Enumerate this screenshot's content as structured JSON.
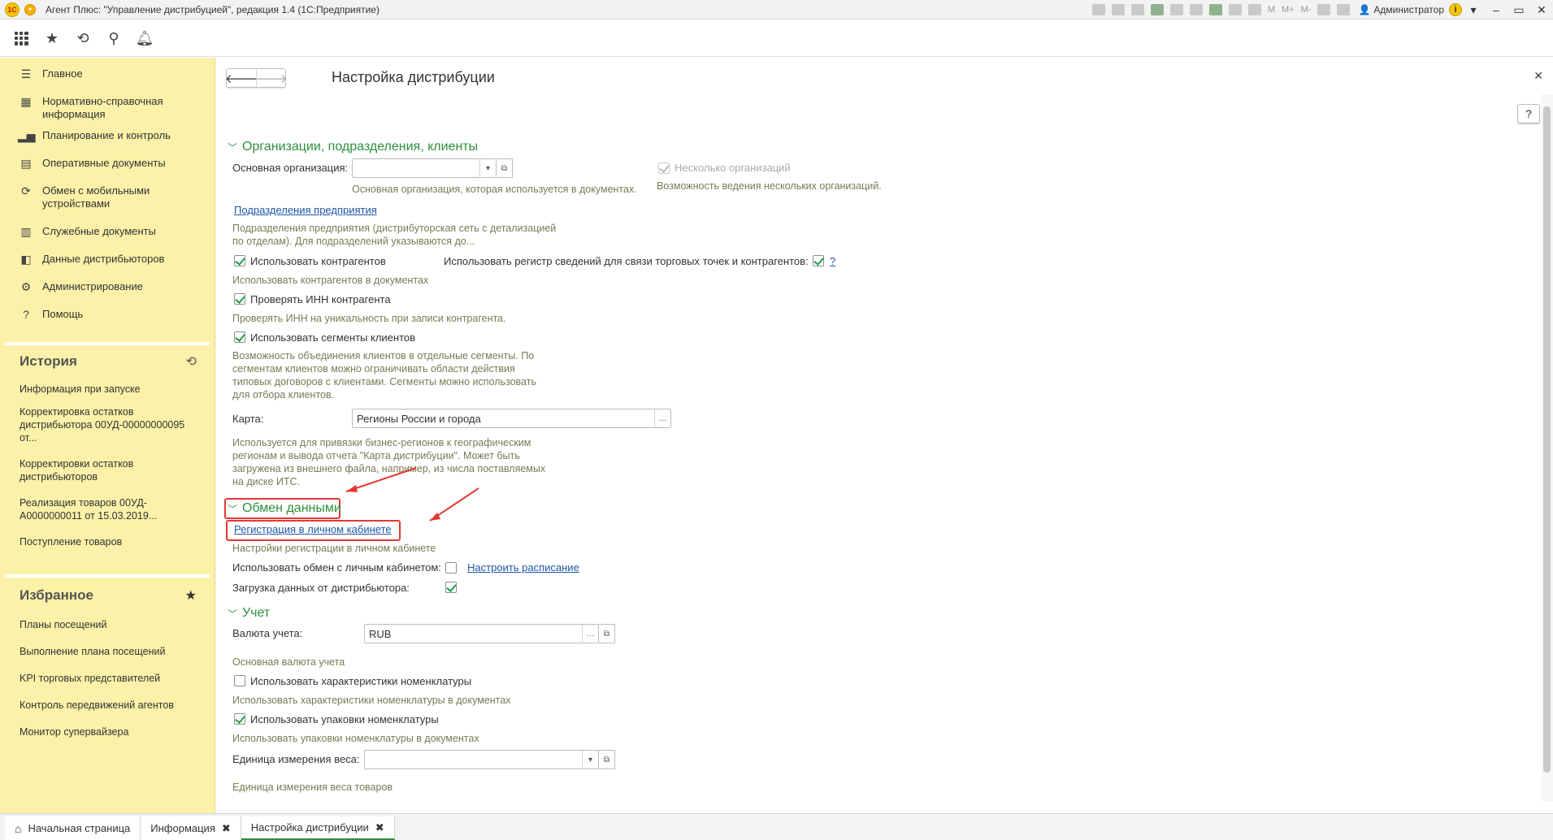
{
  "window": {
    "title": "Агент Плюс: \"Управление дистрибуцией\", редакция 1.4  (1С:Предприятие)",
    "user": "Администратор",
    "toolbar_labels": [
      "M",
      "M+",
      "M-"
    ]
  },
  "sidebar": {
    "nav": [
      {
        "label": "Главное",
        "icon": "menu-lines-icon"
      },
      {
        "label": "Нормативно-справочная информация",
        "icon": "directory-icon"
      },
      {
        "label": "Планирование и контроль",
        "icon": "chart-icon"
      },
      {
        "label": "Оперативные документы",
        "icon": "document-icon"
      },
      {
        "label": "Обмен с мобильными устройствами",
        "icon": "sync-icon"
      },
      {
        "label": "Служебные документы",
        "icon": "service-docs-icon"
      },
      {
        "label": "Данные дистрибьюторов",
        "icon": "distributor-data-icon"
      },
      {
        "label": "Администрирование",
        "icon": "gear-icon"
      },
      {
        "label": "Помощь",
        "icon": "question-icon"
      }
    ],
    "history": {
      "title": "История",
      "items": [
        "Информация при запуске",
        "Корректировка остатков дистрибьютора 00УД-00000000095 от...",
        "Корректировки остатков дистрибьюторов",
        "Реализация товаров 00УД-А0000000011 от 15.03.2019...",
        "Поступление товаров"
      ]
    },
    "favorites": {
      "title": "Избранное",
      "items": [
        "Планы посещений",
        "Выполнение плана посещений",
        "KPI торговых представителей",
        "Контроль передвижений агентов",
        "Монитор супервайзера"
      ]
    }
  },
  "main": {
    "title": "Настройка дистрибуции",
    "help": "?",
    "groups": {
      "orgs": "Организации, подразделения, клиенты",
      "exchange": "Обмен данными",
      "accounting": "Учет"
    },
    "main_org_label": "Основная организация:",
    "main_org_value": "",
    "main_org_hint": "Основная организация, которая используется в документах.",
    "multi_org_label": "Несколько организаций",
    "multi_org_hint": "Возможность ведения нескольких организаций.",
    "divisions_link": "Подразделения предприятия",
    "divisions_hint": "Подразделения предприятия (дистрибуторская сеть с детализацией по отделам). Для подразделений указываются до...",
    "use_contractors": "Использовать контрагентов",
    "use_contractors_hint": "Использовать контрагентов в документах",
    "use_register": "Использовать регистр сведений для связи торговых точек и контрагентов:",
    "use_register_q": "?",
    "check_inn": "Проверять ИНН контрагента",
    "check_inn_hint": "Проверять ИНН на уникальность при записи контрагента.",
    "use_segments": "Использовать сегменты клиентов",
    "segments_hint": "Возможность объединения клиентов в отдельные сегменты. По сегментам клиентов можно ограничивать области действия типовых договоров с клиентами. Сегменты можно использовать для отбора клиентов.",
    "map_label": "Карта:",
    "map_value": "Регионы России и города",
    "map_hint": "Используется для привязки бизнес-регионов к географическим регионам и вывода отчета \"Карта дистрибуции\". Может быть загружена из внешнего файла, например, из числа поставляемых на диске ИТС.",
    "reg_link": "Регистрация в личном кабинете",
    "reg_hint": "Настройки регистрации в личном кабинете",
    "use_exchange": "Использовать обмен с личным кабинетом:",
    "schedule_link": "Настроить расписание",
    "load_data": "Загрузка данных от дистрибьютора:",
    "currency_label": "Валюта учета:",
    "currency_value": "RUB",
    "currency_hint": "Основная валюта учета",
    "use_chars": "Использовать характеристики номенклатуры",
    "use_chars_hint": "Использовать характеристики номенклатуры в документах",
    "use_packs": "Использовать упаковки номенклатуры",
    "use_packs_hint": "Использовать упаковки номенклатуры в документах",
    "weight_label": "Единица измерения веса:",
    "weight_value": "",
    "weight_hint": "Единица измерения веса товаров"
  },
  "tabs": [
    {
      "label": "Начальная страница"
    },
    {
      "label": "Информация"
    },
    {
      "label": "Настройка дистрибуции"
    }
  ],
  "colors": {
    "accent": "#2d8f3d",
    "sidebar": "#fbf1a8",
    "annotation": "#e53935",
    "link": "#1f55a8"
  }
}
